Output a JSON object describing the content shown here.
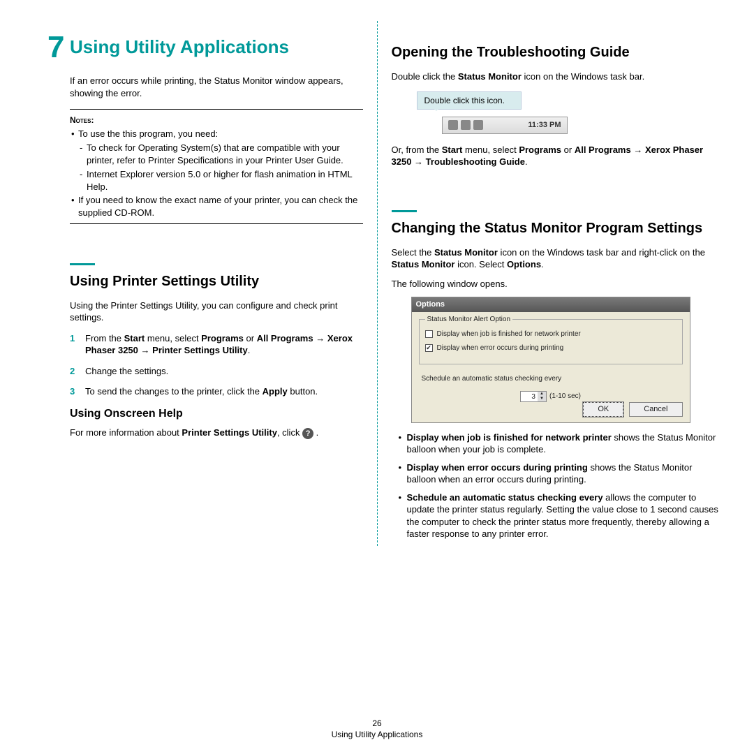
{
  "chapter": {
    "number": "7",
    "title": "Using Utility Applications"
  },
  "intro": "If an error occurs while printing, the Status Monitor window appears, showing the error.",
  "notes": {
    "label": "Notes",
    "b1": "To use the this program, you need:",
    "d1": "To check for Operating System(s) that are compatible with your printer, refer to Printer Specifications in your Printer User Guide.",
    "d2": "Internet Explorer version 5.0 or higher for flash animation in HTML Help.",
    "b2": "If you need to know the exact name of your printer, you can check the supplied CD-ROM."
  },
  "sect1": {
    "title": "Using Printer Settings Utility",
    "p": "Using the Printer Settings Utility, you can configure and check print settings.",
    "s1a": "From the ",
    "s1b": "Start",
    "s1c": " menu, select ",
    "s1d": "Programs",
    "s1e": " or ",
    "s1f": "All Programs",
    "s1g": "Xerox Phaser 3250",
    "s1h": "Printer Settings Utility",
    "s2": "Change the settings.",
    "s3a": "To send the changes to the printer, click the ",
    "s3b": "Apply",
    "s3c": " button.",
    "h3": "Using Onscreen Help",
    "help_a": "For more information about ",
    "help_b": "Printer Settings Utility",
    "help_c": ", click ",
    "help_dot": " ."
  },
  "sect2": {
    "title": "Opening the Troubleshooting Guide",
    "p1a": "Double click the ",
    "p1b": "Status Monitor",
    "p1c": " icon on the Windows task bar.",
    "callout": "Double click this icon.",
    "tray_time": "11:33 PM",
    "p2a": "Or, from the ",
    "p2b": "Start",
    "p2c": " menu, select ",
    "p2d": "Programs",
    "p2e": " or ",
    "p2f": "All Programs",
    "p2g": "Xerox Phaser 3250",
    "p2h": "Troubleshooting Guide"
  },
  "sect3": {
    "title": "Changing the Status Monitor Program Settings",
    "p1a": "Select the ",
    "p1b": "Status Monitor",
    "p1c": " icon on the Windows task bar and right-click on the ",
    "p1d": "Status Monitor",
    "p1e": " icon. Select ",
    "p1f": "Options",
    "p1g": ".",
    "p2": "The following window opens.",
    "b1a": "Display when job is finished for network printer",
    "b1b": " shows the Status Monitor balloon when your job is complete.",
    "b2a": "Display when error occurs during printing",
    "b2b": " shows the Status Monitor balloon when an error occurs during printing.",
    "b3a": "Schedule an automatic status checking every",
    "b3b": " allows the computer to update the printer status regularly. Setting the value close to 1 second causes the computer to check the printer status more frequently, thereby allowing a faster response to any printer error."
  },
  "dialog": {
    "title": "Options",
    "legend": "Status Monitor Alert Option",
    "chk1": "Display when job is finished for network printer",
    "chk2": "Display when error occurs during printing",
    "sched": "Schedule an automatic status checking every",
    "spin": "3",
    "spin_range": "(1-10 sec)",
    "ok": "OK",
    "cancel": "Cancel"
  },
  "footer": {
    "num": "26",
    "text": "Using Utility Applications"
  }
}
